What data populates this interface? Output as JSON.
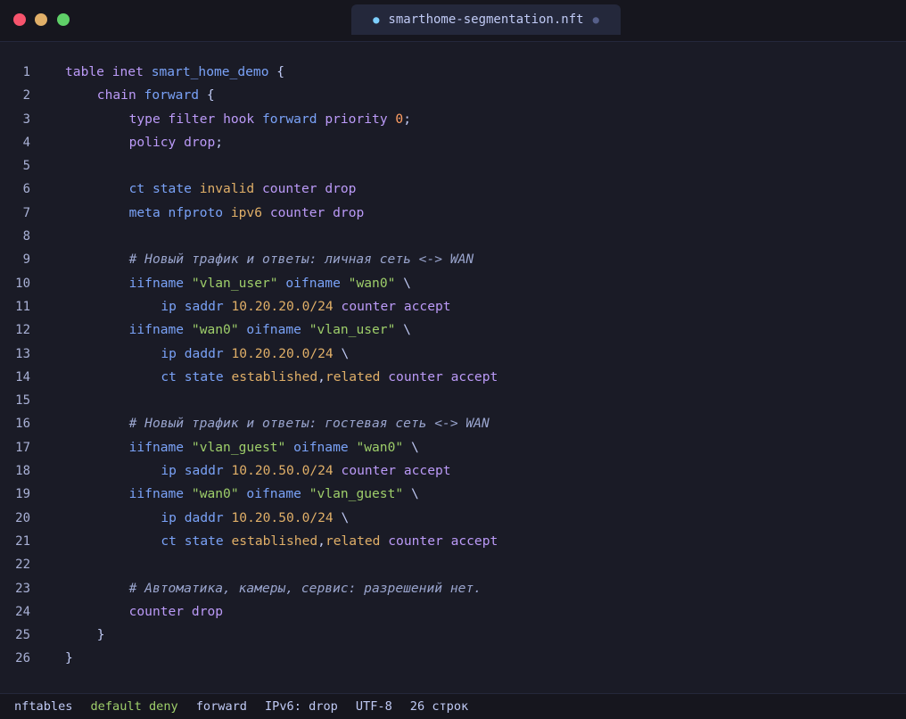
{
  "titlebar": {
    "tab_label": "smarthome-segmentation.nft",
    "tab_bullet": "●",
    "tab_modified": "●"
  },
  "colors": {
    "background": "#1a1b26",
    "keyword": "#bb9af7",
    "identifier": "#7aa2f7",
    "string": "#9ece6a",
    "number": "#ff9e64",
    "value": "#e0af68",
    "comment": "#9aa5ce"
  },
  "editor": {
    "lines": [
      {
        "n": "1",
        "indent": 0,
        "tokens": [
          [
            "kw",
            "table"
          ],
          [
            "pl",
            " "
          ],
          [
            "kw",
            "inet"
          ],
          [
            "pl",
            " "
          ],
          [
            "id",
            "smart_home_demo"
          ],
          [
            "pl",
            " {"
          ]
        ]
      },
      {
        "n": "2",
        "indent": 1,
        "tokens": [
          [
            "kw",
            "chain"
          ],
          [
            "pl",
            " "
          ],
          [
            "id",
            "forward"
          ],
          [
            "pl",
            " {"
          ]
        ]
      },
      {
        "n": "3",
        "indent": 2,
        "tokens": [
          [
            "kw",
            "type"
          ],
          [
            "pl",
            " "
          ],
          [
            "kw",
            "filter"
          ],
          [
            "pl",
            " "
          ],
          [
            "kw",
            "hook"
          ],
          [
            "pl",
            " "
          ],
          [
            "id",
            "forward"
          ],
          [
            "pl",
            " "
          ],
          [
            "kw",
            "priority"
          ],
          [
            "pl",
            " "
          ],
          [
            "num",
            "0"
          ],
          [
            "pl",
            ";"
          ]
        ]
      },
      {
        "n": "4",
        "indent": 2,
        "tokens": [
          [
            "kw",
            "policy"
          ],
          [
            "pl",
            " "
          ],
          [
            "kw",
            "drop"
          ],
          [
            "pl",
            ";"
          ]
        ]
      },
      {
        "n": "5",
        "indent": 0,
        "tokens": []
      },
      {
        "n": "6",
        "indent": 2,
        "tokens": [
          [
            "id",
            "ct"
          ],
          [
            "pl",
            " "
          ],
          [
            "id",
            "state"
          ],
          [
            "pl",
            " "
          ],
          [
            "val",
            "invalid"
          ],
          [
            "pl",
            " "
          ],
          [
            "kw",
            "counter"
          ],
          [
            "pl",
            " "
          ],
          [
            "kw",
            "drop"
          ]
        ]
      },
      {
        "n": "7",
        "indent": 2,
        "tokens": [
          [
            "id",
            "meta"
          ],
          [
            "pl",
            " "
          ],
          [
            "id",
            "nfproto"
          ],
          [
            "pl",
            " "
          ],
          [
            "val",
            "ipv6"
          ],
          [
            "pl",
            " "
          ],
          [
            "kw",
            "counter"
          ],
          [
            "pl",
            " "
          ],
          [
            "kw",
            "drop"
          ]
        ]
      },
      {
        "n": "8",
        "indent": 0,
        "tokens": []
      },
      {
        "n": "9",
        "indent": 2,
        "tokens": [
          [
            "cm",
            "# Новый трафик и ответы: личная сеть <-> WAN"
          ]
        ]
      },
      {
        "n": "10",
        "indent": 2,
        "tokens": [
          [
            "id",
            "iifname"
          ],
          [
            "pl",
            " "
          ],
          [
            "st",
            "\"vlan_user\""
          ],
          [
            "pl",
            " "
          ],
          [
            "id",
            "oifname"
          ],
          [
            "pl",
            " "
          ],
          [
            "st",
            "\"wan0\""
          ],
          [
            "pl",
            " \\"
          ]
        ]
      },
      {
        "n": "11",
        "indent": 3,
        "tokens": [
          [
            "id",
            "ip"
          ],
          [
            "pl",
            " "
          ],
          [
            "id",
            "saddr"
          ],
          [
            "pl",
            " "
          ],
          [
            "val",
            "10.20.20.0/24"
          ],
          [
            "pl",
            " "
          ],
          [
            "kw",
            "counter"
          ],
          [
            "pl",
            " "
          ],
          [
            "kw",
            "accept"
          ]
        ]
      },
      {
        "n": "12",
        "indent": 2,
        "tokens": [
          [
            "id",
            "iifname"
          ],
          [
            "pl",
            " "
          ],
          [
            "st",
            "\"wan0\""
          ],
          [
            "pl",
            " "
          ],
          [
            "id",
            "oifname"
          ],
          [
            "pl",
            " "
          ],
          [
            "st",
            "\"vlan_user\""
          ],
          [
            "pl",
            " \\"
          ]
        ]
      },
      {
        "n": "13",
        "indent": 3,
        "tokens": [
          [
            "id",
            "ip"
          ],
          [
            "pl",
            " "
          ],
          [
            "id",
            "daddr"
          ],
          [
            "pl",
            " "
          ],
          [
            "val",
            "10.20.20.0/24"
          ],
          [
            "pl",
            " \\"
          ]
        ]
      },
      {
        "n": "14",
        "indent": 3,
        "tokens": [
          [
            "id",
            "ct"
          ],
          [
            "pl",
            " "
          ],
          [
            "id",
            "state"
          ],
          [
            "pl",
            " "
          ],
          [
            "val",
            "established"
          ],
          [
            "pl",
            ","
          ],
          [
            "val",
            "related"
          ],
          [
            "pl",
            " "
          ],
          [
            "kw",
            "counter"
          ],
          [
            "pl",
            " "
          ],
          [
            "kw",
            "accept"
          ]
        ]
      },
      {
        "n": "15",
        "indent": 0,
        "tokens": []
      },
      {
        "n": "16",
        "indent": 2,
        "tokens": [
          [
            "cm",
            "# Новый трафик и ответы: гостевая сеть <-> WAN"
          ]
        ]
      },
      {
        "n": "17",
        "indent": 2,
        "tokens": [
          [
            "id",
            "iifname"
          ],
          [
            "pl",
            " "
          ],
          [
            "st",
            "\"vlan_guest\""
          ],
          [
            "pl",
            " "
          ],
          [
            "id",
            "oifname"
          ],
          [
            "pl",
            " "
          ],
          [
            "st",
            "\"wan0\""
          ],
          [
            "pl",
            " \\"
          ]
        ]
      },
      {
        "n": "18",
        "indent": 3,
        "tokens": [
          [
            "id",
            "ip"
          ],
          [
            "pl",
            " "
          ],
          [
            "id",
            "saddr"
          ],
          [
            "pl",
            " "
          ],
          [
            "val",
            "10.20.50.0/24"
          ],
          [
            "pl",
            " "
          ],
          [
            "kw",
            "counter"
          ],
          [
            "pl",
            " "
          ],
          [
            "kw",
            "accept"
          ]
        ]
      },
      {
        "n": "19",
        "indent": 2,
        "tokens": [
          [
            "id",
            "iifname"
          ],
          [
            "pl",
            " "
          ],
          [
            "st",
            "\"wan0\""
          ],
          [
            "pl",
            " "
          ],
          [
            "id",
            "oifname"
          ],
          [
            "pl",
            " "
          ],
          [
            "st",
            "\"vlan_guest\""
          ],
          [
            "pl",
            " \\"
          ]
        ]
      },
      {
        "n": "20",
        "indent": 3,
        "tokens": [
          [
            "id",
            "ip"
          ],
          [
            "pl",
            " "
          ],
          [
            "id",
            "daddr"
          ],
          [
            "pl",
            " "
          ],
          [
            "val",
            "10.20.50.0/24"
          ],
          [
            "pl",
            " \\"
          ]
        ]
      },
      {
        "n": "21",
        "indent": 3,
        "tokens": [
          [
            "id",
            "ct"
          ],
          [
            "pl",
            " "
          ],
          [
            "id",
            "state"
          ],
          [
            "pl",
            " "
          ],
          [
            "val",
            "established"
          ],
          [
            "pl",
            ","
          ],
          [
            "val",
            "related"
          ],
          [
            "pl",
            " "
          ],
          [
            "kw",
            "counter"
          ],
          [
            "pl",
            " "
          ],
          [
            "kw",
            "accept"
          ]
        ]
      },
      {
        "n": "22",
        "indent": 0,
        "tokens": []
      },
      {
        "n": "23",
        "indent": 2,
        "tokens": [
          [
            "cm",
            "# Автоматика, камеры, сервис: разрешений нет."
          ]
        ]
      },
      {
        "n": "24",
        "indent": 2,
        "tokens": [
          [
            "kw",
            "counter"
          ],
          [
            "pl",
            " "
          ],
          [
            "kw",
            "drop"
          ]
        ]
      },
      {
        "n": "25",
        "indent": 1,
        "tokens": [
          [
            "pl",
            "}"
          ]
        ]
      },
      {
        "n": "26",
        "indent": 0,
        "tokens": [
          [
            "pl",
            "}"
          ]
        ]
      }
    ]
  },
  "statusbar": {
    "language": "nftables",
    "policy": "default deny",
    "chain": "forward",
    "ipv6": "IPv6: drop",
    "encoding": "UTF-8",
    "line_count": "26 строк"
  }
}
